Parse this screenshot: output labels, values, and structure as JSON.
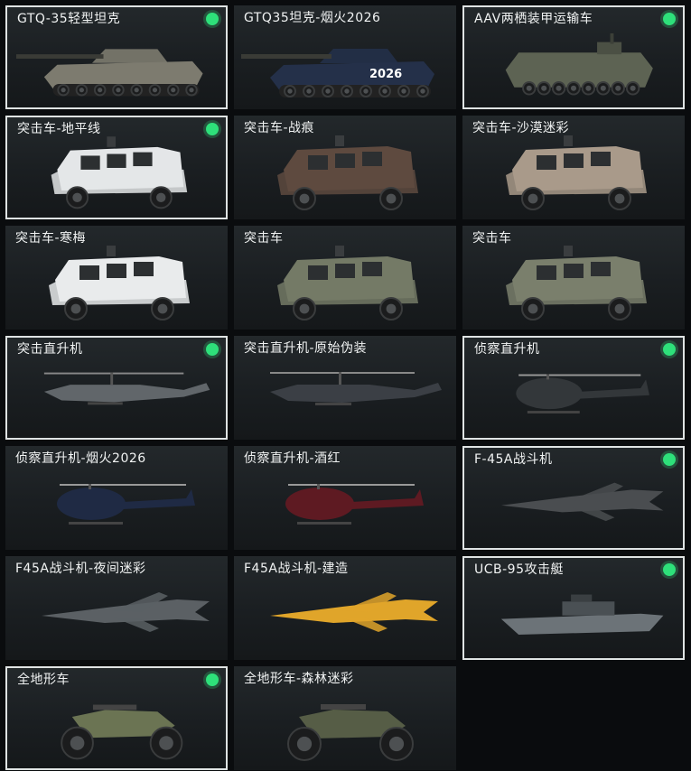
{
  "vehicles": [
    {
      "name": "GTQ-35轻型坦克",
      "owned": true,
      "icon": "light-tank",
      "color": "#7d7b6f"
    },
    {
      "name": "GTQ35坦克-烟火2026",
      "owned": false,
      "icon": "light-tank-fireworks",
      "color": "#243049",
      "badge": "2026"
    },
    {
      "name": "AAV两栖装甲运输车",
      "owned": true,
      "icon": "amphibious-carrier",
      "color": "#5d6353"
    },
    {
      "name": "突击车-地平线",
      "owned": true,
      "icon": "assault-vehicle",
      "color": "#e4e6e8"
    },
    {
      "name": "突击车-战痕",
      "owned": false,
      "icon": "assault-vehicle",
      "color": "#5e4a3f"
    },
    {
      "name": "突击车-沙漠迷彩",
      "owned": false,
      "icon": "assault-vehicle",
      "color": "#a99a8a"
    },
    {
      "name": "突击车-寒梅",
      "owned": false,
      "icon": "assault-vehicle",
      "color": "#e9ebec"
    },
    {
      "name": "突击车",
      "owned": false,
      "icon": "assault-vehicle",
      "color": "#747a66"
    },
    {
      "name": "突击车",
      "owned": false,
      "icon": "assault-vehicle",
      "color": "#7a7f6c"
    },
    {
      "name": "突击直升机",
      "owned": true,
      "icon": "attack-helicopter",
      "color": "#61666a"
    },
    {
      "name": "突击直升机-原始伪装",
      "owned": false,
      "icon": "attack-helicopter",
      "color": "#3b3f45"
    },
    {
      "name": "侦察直升机",
      "owned": true,
      "icon": "scout-helicopter",
      "color": "#33373a"
    },
    {
      "name": "侦察直升机-烟火2026",
      "owned": false,
      "icon": "scout-helicopter",
      "color": "#1f2a44"
    },
    {
      "name": "侦察直升机-酒红",
      "owned": false,
      "icon": "scout-helicopter",
      "color": "#5e1a22"
    },
    {
      "name": "F-45A战斗机",
      "owned": true,
      "icon": "fighter-jet",
      "color": "#4a4d50"
    },
    {
      "name": "F45A战斗机-夜间迷彩",
      "owned": false,
      "icon": "fighter-jet",
      "color": "#5b6064"
    },
    {
      "name": "F45A战斗机-建造",
      "owned": false,
      "icon": "fighter-jet",
      "color": "#e0a52a"
    },
    {
      "name": "UCB-95攻击艇",
      "owned": true,
      "icon": "attack-boat",
      "color": "#6c7378"
    },
    {
      "name": "全地形车",
      "owned": true,
      "icon": "atv",
      "color": "#6b7453"
    },
    {
      "name": "全地形车-森林迷彩",
      "owned": false,
      "icon": "atv",
      "color": "#565d46"
    }
  ],
  "colors": {
    "owned_indicator": "#2ee07a",
    "owned_border": "#dfe3e3"
  }
}
